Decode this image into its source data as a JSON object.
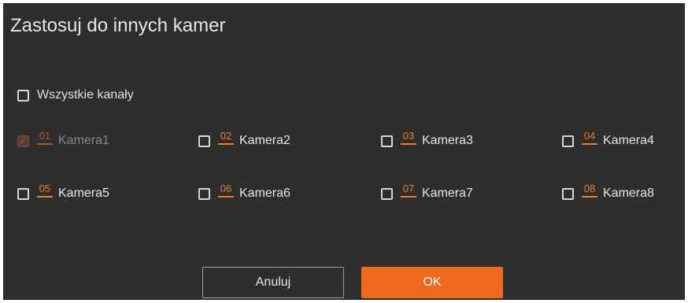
{
  "dialog": {
    "title": "Zastosuj do innych kamer",
    "all_channels_label": "Wszystkie kanały",
    "cameras": [
      {
        "num": "01",
        "name": "Kamera1",
        "checked": true,
        "disabled": true
      },
      {
        "num": "02",
        "name": "Kamera2",
        "checked": false,
        "disabled": false
      },
      {
        "num": "03",
        "name": "Kamera3",
        "checked": false,
        "disabled": false
      },
      {
        "num": "04",
        "name": "Kamera4",
        "checked": false,
        "disabled": false
      },
      {
        "num": "05",
        "name": "Kamera5",
        "checked": false,
        "disabled": false
      },
      {
        "num": "06",
        "name": "Kamera6",
        "checked": false,
        "disabled": false
      },
      {
        "num": "07",
        "name": "Kamera7",
        "checked": false,
        "disabled": false
      },
      {
        "num": "08",
        "name": "Kamera8",
        "checked": false,
        "disabled": false
      }
    ],
    "cancel_label": "Anuluj",
    "ok_label": "OK"
  },
  "colors": {
    "background": "#2e2e2e",
    "accent": "#ef6a1f",
    "text": "#e6e6e6"
  }
}
